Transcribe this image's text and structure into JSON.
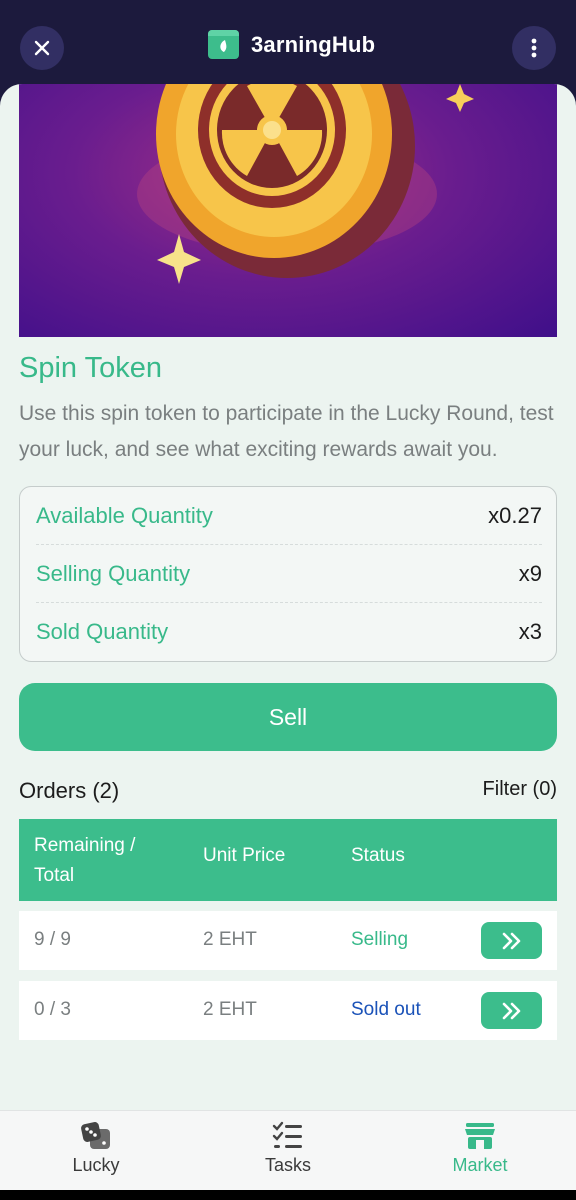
{
  "header": {
    "title": "3arningHub",
    "close_icon": "close-icon",
    "more_icon": "more-vertical-icon"
  },
  "product": {
    "name": "Spin Token",
    "description": "Use this spin token to participate in the Lucky Round, test your luck, and see what exciting rewards await you.",
    "quantities": {
      "available_label": "Available Quantity",
      "available_value": "x0.27",
      "selling_label": "Selling Quantity",
      "selling_value": "x9",
      "sold_label": "Sold Quantity",
      "sold_value": "x3"
    },
    "sell_label": "Sell"
  },
  "orders": {
    "title": "Orders (2)",
    "filter_label": "Filter (0)",
    "columns": {
      "remaining": "Remaining / Total",
      "unit_price": "Unit Price",
      "status": "Status"
    },
    "rows": [
      {
        "remaining": "9 / 9",
        "unit_price": "2 EHT",
        "status": "Selling"
      },
      {
        "remaining": "0 / 3",
        "unit_price": "2 EHT",
        "status": "Sold out"
      }
    ]
  },
  "nav": {
    "items": [
      {
        "label": "Lucky",
        "icon": "dice-icon"
      },
      {
        "label": "Tasks",
        "icon": "checklist-icon"
      },
      {
        "label": "Market",
        "icon": "store-icon",
        "active": true
      }
    ]
  },
  "colors": {
    "accent": "#3cbd8c",
    "header_bg": "#1c1a3d",
    "sold_out": "#1a52b8"
  }
}
